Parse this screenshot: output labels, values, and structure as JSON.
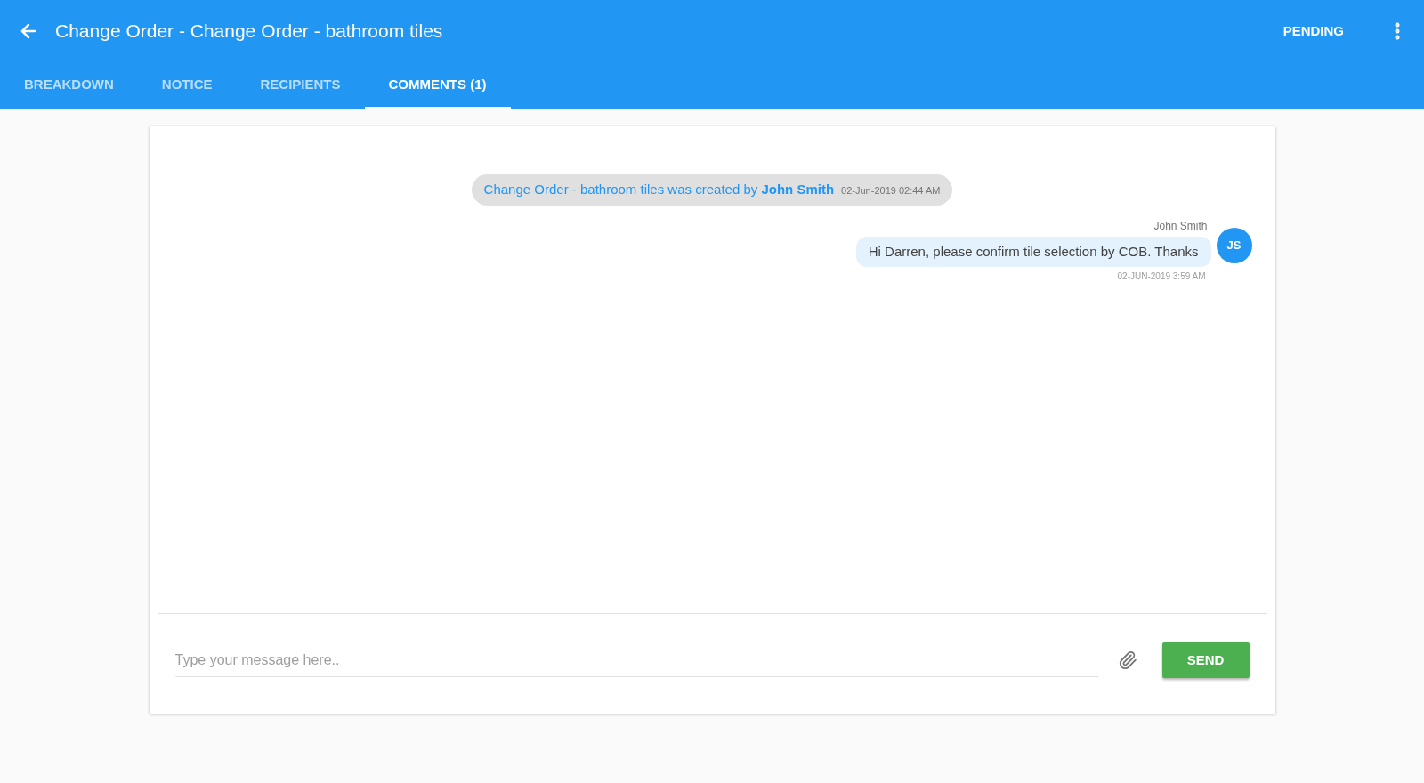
{
  "header": {
    "title": "Change Order - Change Order - bathroom tiles",
    "status": "PENDING"
  },
  "tabs": [
    {
      "label": "BREAKDOWN",
      "selected": false
    },
    {
      "label": "NOTICE",
      "selected": false
    },
    {
      "label": "RECIPIENTS",
      "selected": false
    },
    {
      "label": "COMMENTS (1)",
      "selected": true
    }
  ],
  "messages": [
    {
      "kind": "event",
      "text": "Change Order - bathroom tiles was created by **John Smith**",
      "time": "02-Jun-2019 02:44 AM"
    },
    {
      "kind": "comment",
      "author": "John Smith",
      "text": "Hi Darren, please confirm tile selection by COB. Thanks",
      "initials": "JS",
      "time": "02-JUN-2019 3:59 AM"
    }
  ],
  "composer": {
    "placeholder": "Type your message here..",
    "send": "SEND"
  }
}
